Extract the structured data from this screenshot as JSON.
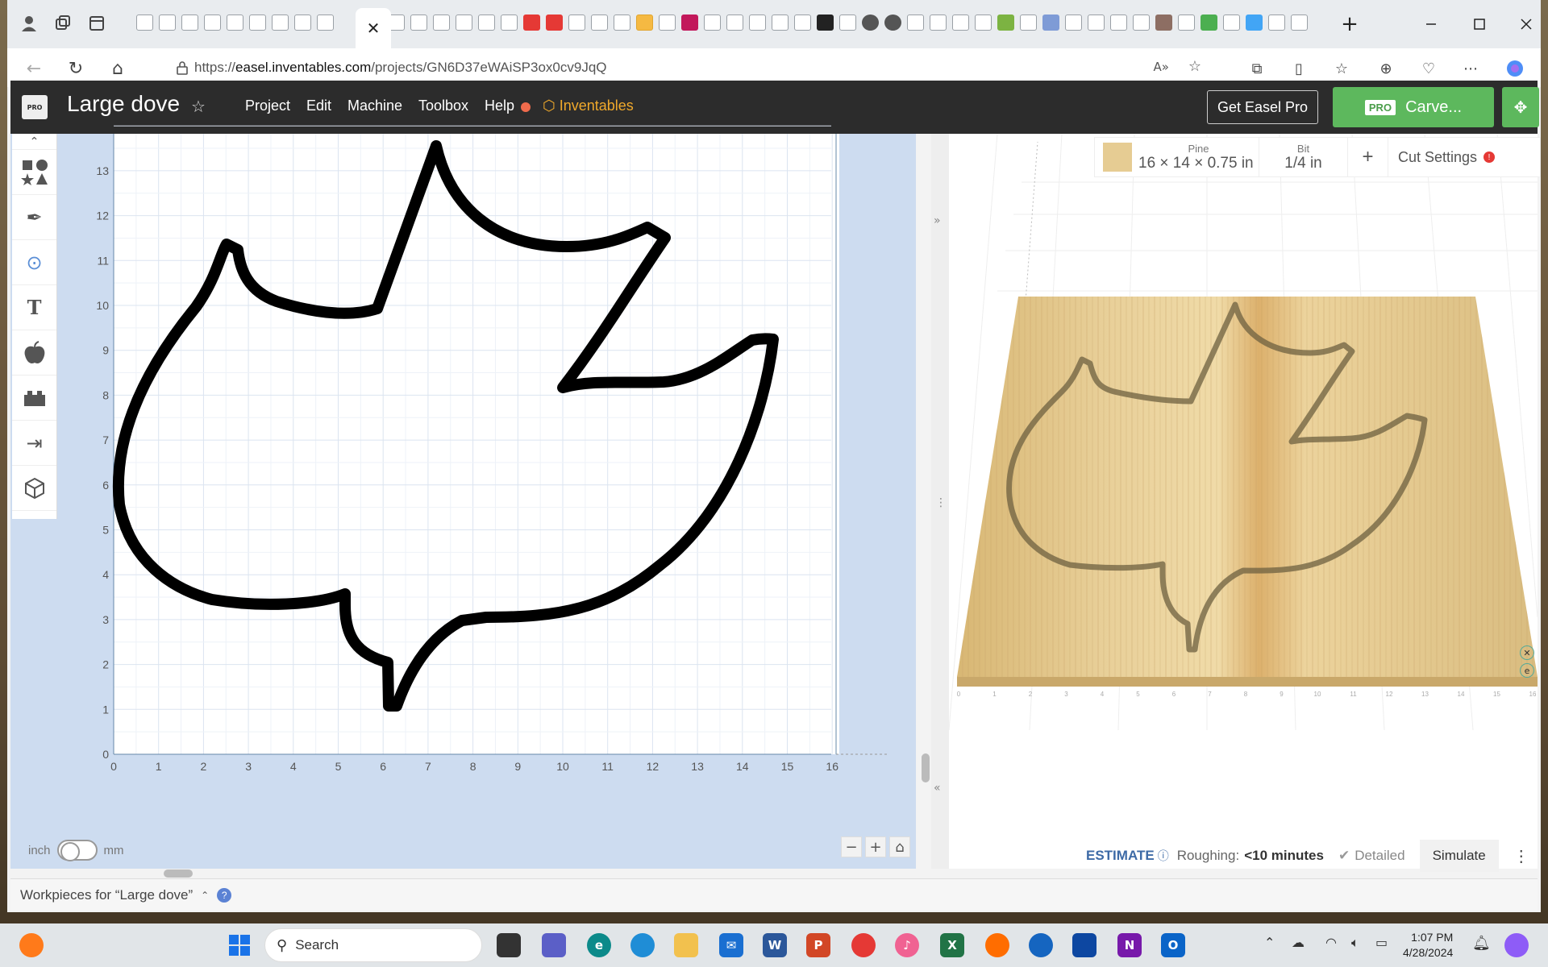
{
  "browser": {
    "url_prefix": "https://",
    "url_host": "easel.inventables.com",
    "url_path": "/projects/GN6D37eWAiSP3ox0cv9JqQ",
    "active_tab_close": "✕",
    "new_tab": "+"
  },
  "app": {
    "logo_text": "PRO",
    "project_title": "Large dove",
    "menu": [
      "Project",
      "Edit",
      "Machine",
      "Toolbox",
      "Help"
    ],
    "brand": "Inventables",
    "get_pro_label": "Get Easel Pro",
    "carve_badge": "PRO",
    "carve_label": "Carve..."
  },
  "tools": [
    "shapes-icon",
    "pen-icon",
    "point-icon",
    "text-icon",
    "apple-icon",
    "blocks-icon",
    "import-icon",
    "cube-icon"
  ],
  "canvas": {
    "x_ticks": [
      "0",
      "1",
      "2",
      "3",
      "4",
      "5",
      "6",
      "7",
      "8",
      "9",
      "10",
      "11",
      "12",
      "13",
      "14",
      "15",
      "16"
    ],
    "y_ticks": [
      "0",
      "1",
      "2",
      "3",
      "4",
      "5",
      "6",
      "7",
      "8",
      "9",
      "10",
      "11",
      "12",
      "13"
    ],
    "units_left": "inch",
    "units_right": "mm"
  },
  "material": {
    "wood_name": "Pine",
    "dimensions": "16 × 14 × 0.75 in",
    "bit_label": "Bit",
    "bit_size": "1/4 in",
    "add": "+",
    "cut_settings": "Cut Settings"
  },
  "estimate": {
    "label": "ESTIMATE",
    "roughing_label": "Roughing:",
    "roughing_value": "<10 minutes",
    "detailed": "Detailed",
    "simulate": "Simulate"
  },
  "workpieces_label": "Workpieces for “Large dove”",
  "taskbar": {
    "search_label": "Search",
    "time": "1:07 PM",
    "date": "4/28/2024"
  },
  "colors": {
    "header_bg": "#2c2c2c",
    "carve_green": "#5db85d",
    "brand_orange": "#f0a92b",
    "canvas_bg": "#cddcf0",
    "estimate_blue": "#3d6aa6"
  }
}
